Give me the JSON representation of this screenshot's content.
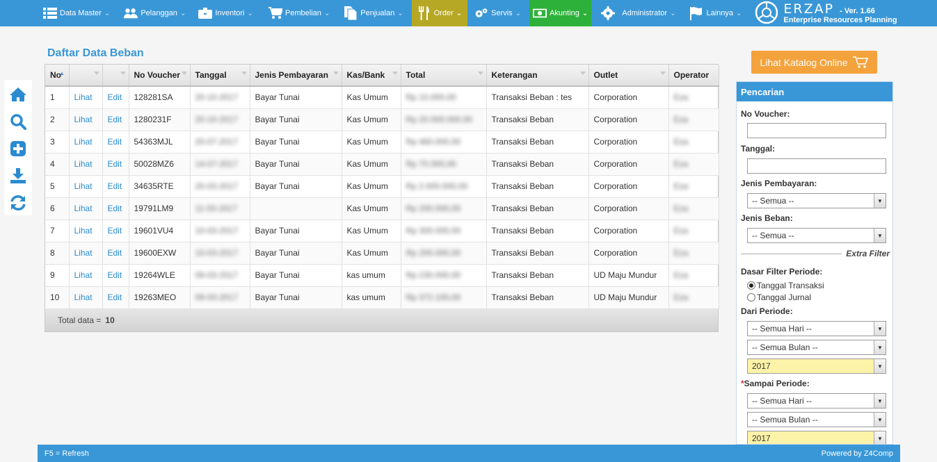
{
  "nav": {
    "items": [
      {
        "label": "Data Master",
        "icon": "list-icon"
      },
      {
        "label": "Pelanggan",
        "icon": "users-icon"
      },
      {
        "label": "Inventori",
        "icon": "briefcase-icon"
      },
      {
        "label": "Pembelian",
        "icon": "cart-icon"
      },
      {
        "label": "Penjualan",
        "icon": "document-icon"
      },
      {
        "label": "Order",
        "icon": "fork-knife-icon"
      },
      {
        "label": "Servis",
        "icon": "gears-icon"
      },
      {
        "label": "Akunting",
        "icon": "money-icon"
      },
      {
        "label": "Administrator",
        "icon": "gear-icon"
      },
      {
        "label": "Lainnya",
        "icon": "flag-icon"
      }
    ],
    "order_color": "#b6a824",
    "akunting_color": "#2db13a"
  },
  "brand": {
    "logo": "ERZAP",
    "version": "- Ver. 1.66",
    "subtitle": "Enterprise Resources Planning"
  },
  "page": {
    "title": "Daftar Data Beban"
  },
  "table": {
    "columns": [
      "No",
      "",
      "",
      "No Voucher",
      "Tanggal",
      "Jenis Pembayaran",
      "Kas/Bank",
      "Total",
      "Keterangan",
      "Outlet",
      "Operator"
    ],
    "view_label": "Lihat",
    "edit_label": "Edit",
    "rows": [
      {
        "no": "1",
        "voucher": "128281SA",
        "tanggal": "20-10-2017",
        "jenis": "Bayar Tunai",
        "kas": "Kas Umum",
        "total": "Rp 10.000,00",
        "ket": "Transaksi Beban : tes",
        "outlet": "Corporation",
        "op": "Eza"
      },
      {
        "no": "2",
        "voucher": "1280231F",
        "tanggal": "20-10-2017",
        "jenis": "Bayar Tunai",
        "kas": "Kas Umum",
        "total": "Rp 20.000.000,00",
        "ket": "Transaksi Beban",
        "outlet": "Corporation",
        "op": "Eza"
      },
      {
        "no": "3",
        "voucher": "54363MJL",
        "tanggal": "20-07-2017",
        "jenis": "Bayar Tunai",
        "kas": "Kas Umum",
        "total": "Rp 460.000,00",
        "ket": "Transaksi Beban",
        "outlet": "Corporation",
        "op": "Eza"
      },
      {
        "no": "4",
        "voucher": "50028MZ6",
        "tanggal": "14-07-2017",
        "jenis": "Bayar Tunai",
        "kas": "Kas Umum",
        "total": "Rp 70.000,00",
        "ket": "Transaksi Beban",
        "outlet": "Corporation",
        "op": "Eza"
      },
      {
        "no": "5",
        "voucher": "34635RTE",
        "tanggal": "20-03-2017",
        "jenis": "Bayar Tunai",
        "kas": "Kas Umum",
        "total": "Rp 2.000.000,00",
        "ket": "Transaksi Beban",
        "outlet": "Corporation",
        "op": "Eza"
      },
      {
        "no": "6",
        "voucher": "19791LM9",
        "tanggal": "11-03-2017",
        "jenis": "",
        "kas": "Kas Umum",
        "total": "Rp 200.000,00",
        "ket": "Transaksi Beban",
        "outlet": "Corporation",
        "op": "Eza"
      },
      {
        "no": "7",
        "voucher": "19601VU4",
        "tanggal": "10-03-2017",
        "jenis": "Bayar Tunai",
        "kas": "Kas Umum",
        "total": "Rp 300.000,00",
        "ket": "Transaksi Beban",
        "outlet": "Corporation",
        "op": "Eza"
      },
      {
        "no": "8",
        "voucher": "19600EXW",
        "tanggal": "10-03-2017",
        "jenis": "Bayar Tunai",
        "kas": "Kas Umum",
        "total": "Rp 200.000,00",
        "ket": "Transaksi Beban",
        "outlet": "Corporation",
        "op": "Eza"
      },
      {
        "no": "9",
        "voucher": "19264WLE",
        "tanggal": "09-03-2017",
        "jenis": "Bayar Tunai",
        "kas": "kas umum",
        "total": "Rp 230.000,00",
        "ket": "Transaksi Beban",
        "outlet": "UD Maju Mundur",
        "op": "Eza"
      },
      {
        "no": "10",
        "voucher": "19263MEO",
        "tanggal": "09-03-2017",
        "jenis": "Bayar Tunai",
        "kas": "kas umum",
        "total": "Rp 372.100,00",
        "ket": "Transaksi Beban",
        "outlet": "UD Maju Mundur",
        "op": "Eza"
      }
    ],
    "footer_label": "Total data =",
    "footer_count": "10"
  },
  "katalog": {
    "label": "Lihat Katalog Online"
  },
  "search": {
    "title": "Pencarian",
    "voucher_label": "No Voucher:",
    "tanggal_label": "Tanggal:",
    "jenis_pembayaran_label": "Jenis Pembayaran:",
    "jenis_pembayaran_value": "-- Semua --",
    "jenis_beban_label": "Jenis Beban:",
    "jenis_beban_value": "-- Semua --",
    "extra_filter": "Extra Filter",
    "dasar_label": "Dasar Filter Periode:",
    "radio_transaksi": "Tanggal Transaksi",
    "radio_jurnal": "Tanggal Jurnal",
    "dari_label": "Dari Periode:",
    "dari_hari": "-- Semua Hari --",
    "dari_bulan": "-- Semua Bulan --",
    "dari_tahun": "2017",
    "sampai_label": "Sampai Periode:",
    "sampai_required": "*",
    "sampai_hari": "-- Semua Hari --",
    "sampai_bulan": "-- Semua Bulan --",
    "sampai_tahun": "2017"
  },
  "footer": {
    "left": "F5 = Refresh",
    "right": "Powered by Z4Comp"
  }
}
